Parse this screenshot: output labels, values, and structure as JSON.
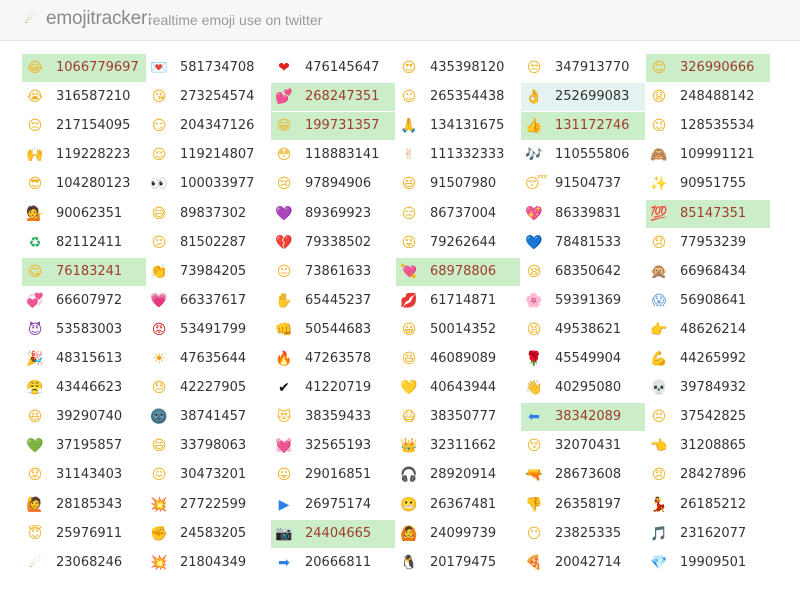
{
  "header": {
    "title": "emojitracker:",
    "tagline": "realtime emoji use on twitter",
    "logo_glyph": "☄"
  },
  "colors": {
    "highlight_bg": "#cbeec8",
    "highlight_text": "#a03b2d",
    "soft_highlight_bg": "#e4f3f1",
    "count_text": "#333333"
  },
  "cells": [
    {
      "emoji": "😂",
      "count": "1066779697",
      "hl": "strong",
      "color": "#f0b429"
    },
    {
      "emoji": "💌",
      "count": "581734708",
      "color": "#c0392b"
    },
    {
      "emoji": "❤",
      "count": "476145647",
      "color": "#e0221f"
    },
    {
      "emoji": "😍",
      "count": "435398120",
      "color": "#f0b429"
    },
    {
      "emoji": "😒",
      "count": "347913770",
      "color": "#f0b429"
    },
    {
      "emoji": "😊",
      "count": "326990666",
      "hl": "strong",
      "color": "#f0b429"
    },
    {
      "emoji": "😭",
      "count": "316587210",
      "color": "#f0b429"
    },
    {
      "emoji": "😘",
      "count": "273254574",
      "color": "#f0b429"
    },
    {
      "emoji": "💕",
      "count": "268247351",
      "hl": "strong",
      "color": "#e8507a"
    },
    {
      "emoji": "☺",
      "count": "265354438",
      "color": "#f0b429"
    },
    {
      "emoji": "👌",
      "count": "252699083",
      "hl": "soft",
      "color": "#d8a270"
    },
    {
      "emoji": "😩",
      "count": "248488142",
      "color": "#f0b429"
    },
    {
      "emoji": "😔",
      "count": "217154095",
      "color": "#f0b429"
    },
    {
      "emoji": "😏",
      "count": "204347126",
      "color": "#f0b429"
    },
    {
      "emoji": "😁",
      "count": "199731357",
      "hl": "strong",
      "color": "#f0b429"
    },
    {
      "emoji": "🙏",
      "count": "134131675",
      "color": "#d8a270"
    },
    {
      "emoji": "👍",
      "count": "131172746",
      "hl": "strong",
      "color": "#d8a270"
    },
    {
      "emoji": "😉",
      "count": "128535534",
      "color": "#f0b429"
    },
    {
      "emoji": "🙌",
      "count": "119228223",
      "color": "#d8a270"
    },
    {
      "emoji": "😌",
      "count": "119214807",
      "color": "#f0b429"
    },
    {
      "emoji": "😳",
      "count": "118883141",
      "color": "#f0b429"
    },
    {
      "emoji": "✌",
      "count": "111332333",
      "color": "#d8a270"
    },
    {
      "emoji": "🎶",
      "count": "110555806",
      "color": "#555555"
    },
    {
      "emoji": "🙈",
      "count": "109991121",
      "color": "#8b5a2b"
    },
    {
      "emoji": "😎",
      "count": "104280123",
      "color": "#f0b429"
    },
    {
      "emoji": "👀",
      "count": "100033977",
      "color": "#333333"
    },
    {
      "emoji": "😢",
      "count": "97894906",
      "color": "#f0b429"
    },
    {
      "emoji": "😃",
      "count": "91507980",
      "color": "#f0b429"
    },
    {
      "emoji": "😴",
      "count": "91504737",
      "color": "#f0b429"
    },
    {
      "emoji": "✨",
      "count": "90951755",
      "color": "#f5c518"
    },
    {
      "emoji": "💁",
      "count": "90062351",
      "color": "#8b4513"
    },
    {
      "emoji": "😅",
      "count": "89837302",
      "color": "#f0b429"
    },
    {
      "emoji": "💜",
      "count": "89369923",
      "color": "#8e44ad"
    },
    {
      "emoji": "😑",
      "count": "86737004",
      "color": "#f0b429"
    },
    {
      "emoji": "💖",
      "count": "86339831",
      "color": "#e8507a"
    },
    {
      "emoji": "💯",
      "count": "85147351",
      "hl": "strong",
      "color": "#d0312d"
    },
    {
      "emoji": "♻",
      "count": "82112411",
      "color": "#27ae60"
    },
    {
      "emoji": "😕",
      "count": "81502287",
      "color": "#f0b429"
    },
    {
      "emoji": "💔",
      "count": "79338502",
      "color": "#e0221f"
    },
    {
      "emoji": "😜",
      "count": "79262644",
      "color": "#f0b429"
    },
    {
      "emoji": "💙",
      "count": "78481533",
      "color": "#2f80ed"
    },
    {
      "emoji": "😞",
      "count": "77953239",
      "color": "#f0b429"
    },
    {
      "emoji": "😋",
      "count": "76183241",
      "hl": "strong",
      "color": "#f0b429"
    },
    {
      "emoji": "👏",
      "count": "73984205",
      "color": "#d8a270"
    },
    {
      "emoji": "😐",
      "count": "73861633",
      "color": "#f0b429"
    },
    {
      "emoji": "💘",
      "count": "68978806",
      "hl": "strong",
      "color": "#e8507a"
    },
    {
      "emoji": "😪",
      "count": "68350642",
      "color": "#f0b429"
    },
    {
      "emoji": "🙊",
      "count": "66968434",
      "color": "#8b5a2b"
    },
    {
      "emoji": "💞",
      "count": "66607972",
      "color": "#e8507a"
    },
    {
      "emoji": "💗",
      "count": "66337617",
      "color": "#e8507a"
    },
    {
      "emoji": "✋",
      "count": "65445237",
      "color": "#d8a270"
    },
    {
      "emoji": "💋",
      "count": "61714871",
      "color": "#d0312d"
    },
    {
      "emoji": "🌸",
      "count": "59391369",
      "color": "#f19cbb"
    },
    {
      "emoji": "😱",
      "count": "56908641",
      "color": "#6fa8dc"
    },
    {
      "emoji": "😈",
      "count": "53583003",
      "color": "#8e44ad"
    },
    {
      "emoji": "😡",
      "count": "53491799",
      "color": "#d0312d"
    },
    {
      "emoji": "👊",
      "count": "50544683",
      "color": "#d8a270"
    },
    {
      "emoji": "😀",
      "count": "50014352",
      "color": "#f0b429"
    },
    {
      "emoji": "😫",
      "count": "49538621",
      "color": "#f0b429"
    },
    {
      "emoji": "👉",
      "count": "48626214",
      "color": "#d8a270"
    },
    {
      "emoji": "🎉",
      "count": "48315613",
      "color": "#e67e22"
    },
    {
      "emoji": "☀",
      "count": "47635644",
      "color": "#f39c12"
    },
    {
      "emoji": "🔥",
      "count": "47263578",
      "color": "#e67e22"
    },
    {
      "emoji": "😆",
      "count": "46089089",
      "color": "#f0b429"
    },
    {
      "emoji": "🌹",
      "count": "45549904",
      "color": "#c0392b"
    },
    {
      "emoji": "💪",
      "count": "44265992",
      "color": "#d8a270"
    },
    {
      "emoji": "😤",
      "count": "43446623",
      "color": "#f0b429"
    },
    {
      "emoji": "😓",
      "count": "42227905",
      "color": "#f0b429"
    },
    {
      "emoji": "✔",
      "count": "41220719",
      "color": "#111111"
    },
    {
      "emoji": "💛",
      "count": "40643944",
      "color": "#f5c518"
    },
    {
      "emoji": "👋",
      "count": "40295080",
      "color": "#d8a270"
    },
    {
      "emoji": "💀",
      "count": "39784932",
      "color": "#777777"
    },
    {
      "emoji": "😆",
      "count": "39290740",
      "color": "#f0b429"
    },
    {
      "emoji": "🌚",
      "count": "38741457",
      "color": "#555555"
    },
    {
      "emoji": "😻",
      "count": "38359433",
      "color": "#f0b429"
    },
    {
      "emoji": "😷",
      "count": "38350777",
      "color": "#f0b429"
    },
    {
      "emoji": "⬅",
      "count": "38342089",
      "hl": "strong",
      "color": "#2f80ed"
    },
    {
      "emoji": "😣",
      "count": "37542825",
      "color": "#f0b429"
    },
    {
      "emoji": "💚",
      "count": "37195857",
      "color": "#27ae60"
    },
    {
      "emoji": "😄",
      "count": "33798063",
      "color": "#f0b429"
    },
    {
      "emoji": "💓",
      "count": "32565193",
      "color": "#e8507a"
    },
    {
      "emoji": "👑",
      "count": "32311662",
      "color": "#f5c518"
    },
    {
      "emoji": "😚",
      "count": "32070431",
      "color": "#f0b429"
    },
    {
      "emoji": "👈",
      "count": "31208865",
      "color": "#d8a270"
    },
    {
      "emoji": "😟",
      "count": "31143403",
      "color": "#f0b429"
    },
    {
      "emoji": "😖",
      "count": "30473201",
      "color": "#f0b429"
    },
    {
      "emoji": "😛",
      "count": "29016851",
      "color": "#f0b429"
    },
    {
      "emoji": "🎧",
      "count": "28920914",
      "color": "#555555"
    },
    {
      "emoji": "🔫",
      "count": "28673608",
      "color": "#555555"
    },
    {
      "emoji": "😠",
      "count": "28427896",
      "color": "#f0b429"
    },
    {
      "emoji": "🙋",
      "count": "28185343",
      "color": "#8b4513"
    },
    {
      "emoji": "💥",
      "count": "27722599",
      "color": "#f39c12"
    },
    {
      "emoji": "▶",
      "count": "26975174",
      "color": "#2f80ed"
    },
    {
      "emoji": "😬",
      "count": "26367481",
      "color": "#f0b429"
    },
    {
      "emoji": "👎",
      "count": "26358197",
      "color": "#d8a270"
    },
    {
      "emoji": "💃",
      "count": "26185212",
      "color": "#c0392b"
    },
    {
      "emoji": "😇",
      "count": "25976911",
      "color": "#f0b429"
    },
    {
      "emoji": "✊",
      "count": "24583205",
      "color": "#d8a270"
    },
    {
      "emoji": "📷",
      "count": "24404665",
      "hl": "strong",
      "color": "#555555"
    },
    {
      "emoji": "🙆",
      "count": "24099739",
      "color": "#8b4513"
    },
    {
      "emoji": "😶",
      "count": "23825335",
      "color": "#f0b429"
    },
    {
      "emoji": "🎵",
      "count": "23162077",
      "color": "#6c5ce7"
    },
    {
      "emoji": "☄",
      "count": "23068246",
      "color": "#c8b27a"
    },
    {
      "emoji": "💥",
      "count": "21804349",
      "color": "#e74c3c"
    },
    {
      "emoji": "➡",
      "count": "20666811",
      "color": "#2f80ed"
    },
    {
      "emoji": "🐧",
      "count": "20179475",
      "color": "#333333"
    },
    {
      "emoji": "🍕",
      "count": "20042714",
      "color": "#e67e22"
    },
    {
      "emoji": "💎",
      "count": "19909501",
      "color": "#5dade2"
    }
  ]
}
